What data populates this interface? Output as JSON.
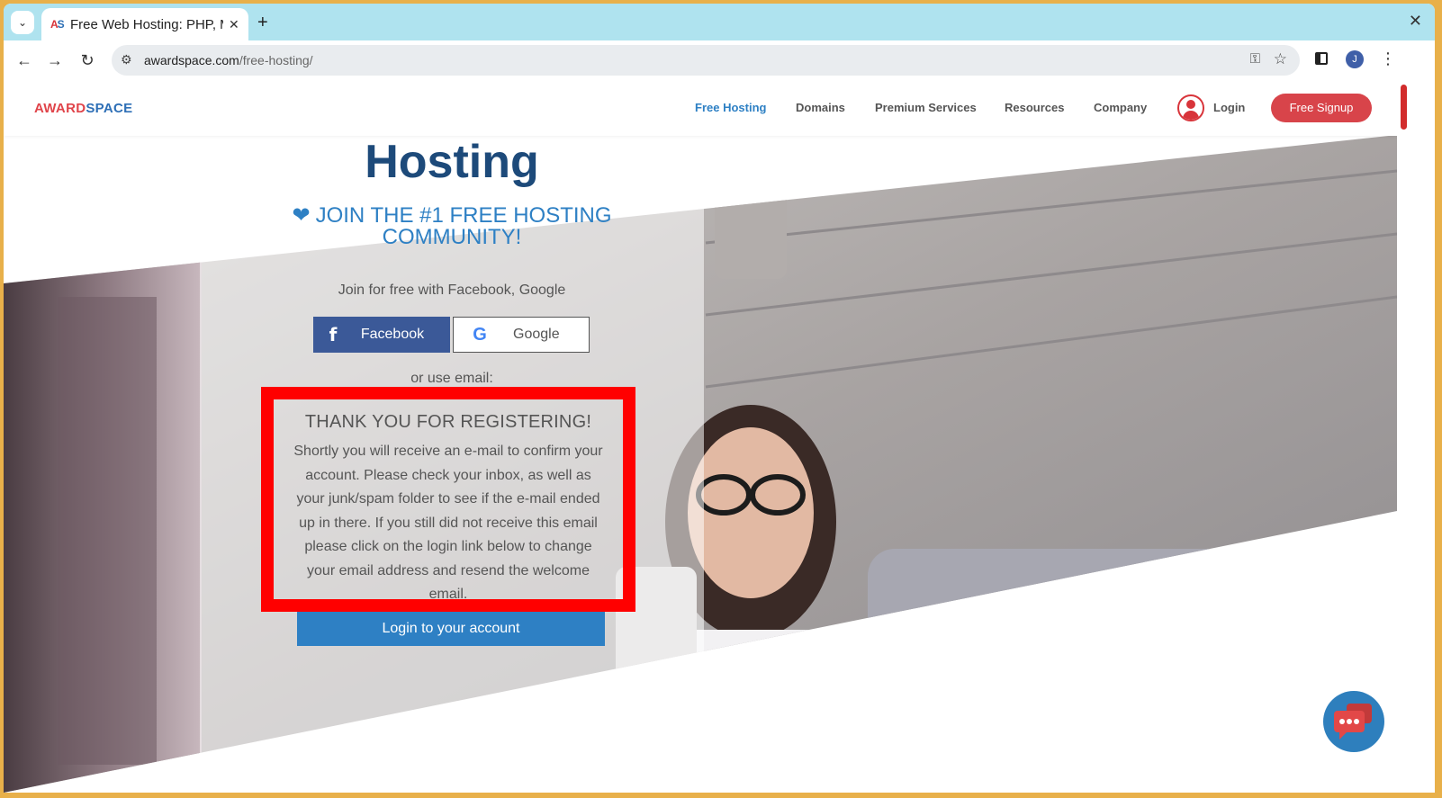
{
  "browser": {
    "tab": {
      "favicon_a": "A",
      "favicon_s": "S",
      "title": "Free Web Hosting: PHP, M",
      "close": "✕"
    },
    "new_tab": "+",
    "window_close": "✕",
    "url_host": "awardspace.com",
    "url_path": "/free-hosting/",
    "profile_initial": "J"
  },
  "site": {
    "logo_a": "AWARD",
    "logo_b": "SPACE",
    "nav": [
      {
        "label": "Free Hosting",
        "active": true
      },
      {
        "label": "Domains"
      },
      {
        "label": "Premium Services"
      },
      {
        "label": "Resources"
      },
      {
        "label": "Company"
      }
    ],
    "login_label": "Login",
    "signup_label": "Free Signup"
  },
  "hero": {
    "title": "Hosting",
    "community": "JOIN THE #1 FREE HOSTING COMMUNITY!",
    "join_social": "Join for free with Facebook, Google",
    "facebook_label": "Facebook",
    "google_label": "Google",
    "or_email": "or use email:",
    "thanks_title": "THANK YOU FOR REGISTERING!",
    "thanks_text": "Shortly you will receive an e-mail to confirm your account. Please check your inbox, as well as your junk/spam folder to see if the e-mail ended up in there. If you still did not receive this email please click on the login link below to change your email address and resend the welcome email.",
    "login_button": "Login to your account"
  },
  "colors": {
    "accent_blue": "#2e80c4",
    "brand_red": "#d8444a",
    "highlight": "#ff0000",
    "facebook": "#3b5998"
  }
}
